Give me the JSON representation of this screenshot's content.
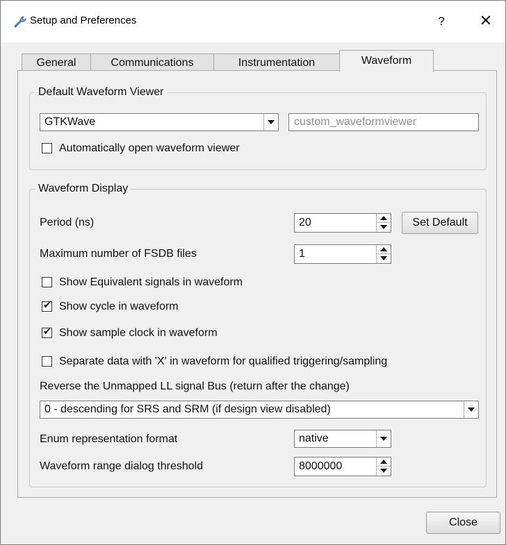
{
  "window": {
    "title": "Setup and Preferences",
    "help_label": "?",
    "close_glyph": "✕",
    "icon": "wrench-icon"
  },
  "tabs": [
    {
      "label": "General",
      "active": false
    },
    {
      "label": "Communications",
      "active": false
    },
    {
      "label": "Instrumentation",
      "active": false
    },
    {
      "label": "Waveform",
      "active": true
    }
  ],
  "default_viewer": {
    "group_title": "Default Waveform Viewer",
    "viewer_selected": "GTKWave",
    "custom_placeholder": "custom_waveformviewer",
    "auto_open_label": "Automatically open waveform viewer",
    "auto_open_checked": false
  },
  "display": {
    "group_title": "Waveform Display",
    "period_label": "Period (ns)",
    "period_value": "20",
    "set_default_label": "Set Default",
    "max_fsdb_label": "Maximum number of FSDB files",
    "max_fsdb_value": "1",
    "show_equiv_label": "Show Equivalent signals in waveform",
    "show_equiv_checked": false,
    "show_cycle_label": "Show cycle in waveform",
    "show_cycle_checked": true,
    "show_sample_label": "Show sample clock in waveform",
    "show_sample_checked": true,
    "separate_x_label": "Separate data with 'X' in waveform for  qualified triggering/sampling",
    "separate_x_checked": false,
    "reverse_label": "Reverse the Unmapped LL signal Bus (return after the change)",
    "reverse_selected": "0 - descending for SRS and SRM (if design view disabled)",
    "enum_label": "Enum representation format",
    "enum_selected": "native",
    "range_label": "Waveform range dialog threshold",
    "range_value": "8000000"
  },
  "footer": {
    "close_label": "Close"
  }
}
